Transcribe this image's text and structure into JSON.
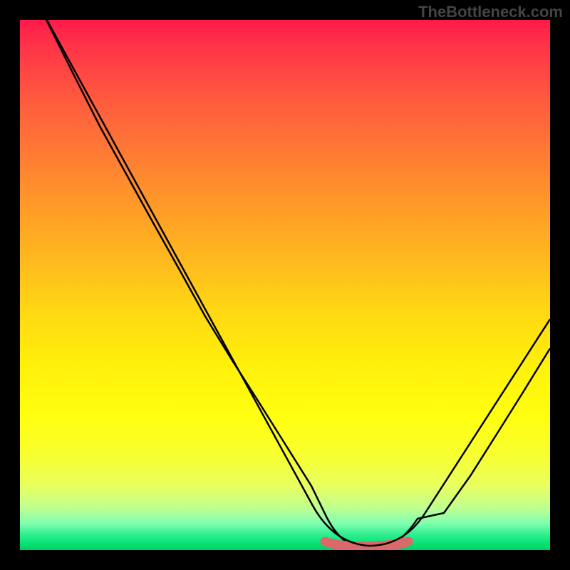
{
  "watermark": "TheBottleneck.com",
  "chart_data": {
    "type": "line",
    "title": "",
    "xlabel": "",
    "ylabel": "",
    "xlim": [
      0,
      100
    ],
    "ylim": [
      0,
      100
    ],
    "grid": false,
    "background_gradient": {
      "top_color": "#ff1a4a",
      "bottom_color": "#00d060",
      "description": "vertical gradient from red (top) through orange, yellow, to green (bottom)"
    },
    "series": [
      {
        "name": "bottleneck-curve",
        "color": "#000000",
        "x": [
          5,
          10,
          15,
          20,
          25,
          30,
          35,
          40,
          45,
          50,
          55,
          58,
          62,
          68,
          72,
          75,
          80,
          85,
          90,
          95,
          100
        ],
        "y": [
          100,
          90,
          80,
          71,
          62,
          53,
          44,
          36,
          28,
          20,
          12,
          6,
          2,
          0.5,
          0.5,
          2,
          7,
          14,
          22,
          30,
          38
        ]
      },
      {
        "name": "optimal-plateau",
        "color": "#d9696b",
        "x": [
          58,
          62,
          66,
          70,
          73
        ],
        "y": [
          1.5,
          0.8,
          0.5,
          0.8,
          1.5
        ]
      }
    ],
    "annotations": []
  }
}
